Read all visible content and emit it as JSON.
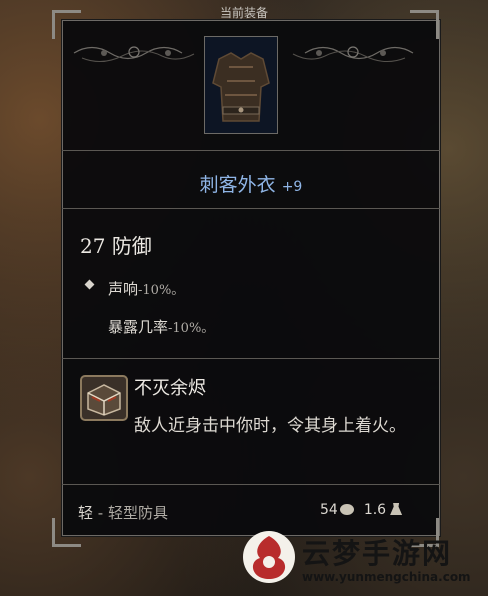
{
  "header": {
    "title": "当前装备"
  },
  "item": {
    "name": "刺客外衣",
    "upgrade": "+9",
    "name_color": "#8fb5e6",
    "icon": "leather-armor-icon"
  },
  "stats": {
    "armor_value": "27",
    "armor_label": "防御",
    "properties": [
      {
        "label": "声响",
        "value": "-10%。"
      },
      {
        "label": "暴露几率",
        "value": "-10%。"
      }
    ]
  },
  "passive": {
    "icon": "charred-box-icon",
    "title": "不灭余烬",
    "description": "敌人近身击中你时，令其身上着火。"
  },
  "footer": {
    "type_short": "轻",
    "type_full": " - 轻型防具",
    "price": "54",
    "price_icon": "coin-icon",
    "weight": "1.6",
    "weight_icon": "weight-icon"
  },
  "watermark": {
    "title": "云梦手游网",
    "url": "www.yunmengchina.com"
  }
}
